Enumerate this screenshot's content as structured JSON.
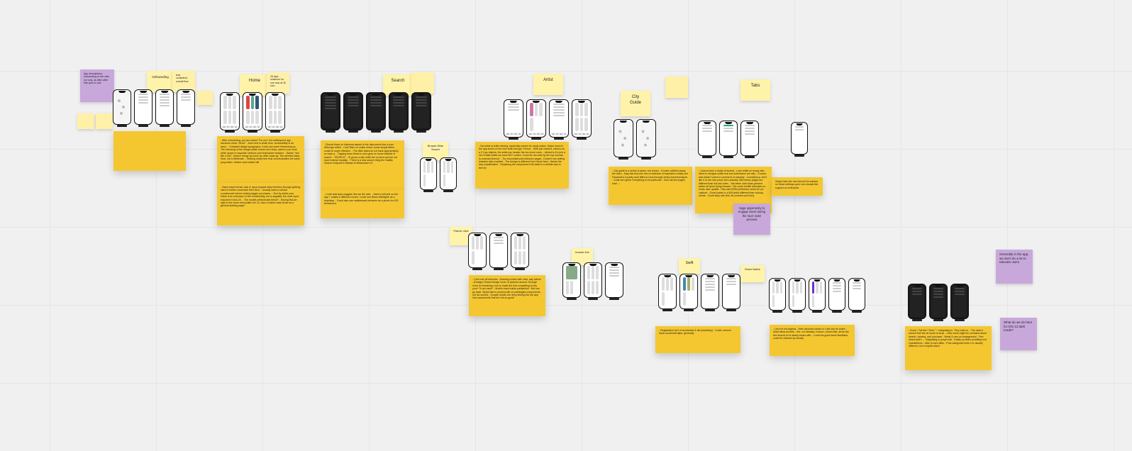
{
  "sections": {
    "home": {
      "label": "Home"
    },
    "search": {
      "label": "Search"
    },
    "artist": {
      "label": "Artist"
    },
    "cityguide": {
      "label": "City\nGuide"
    },
    "tabs": {
      "label": "Tabs"
    },
    "browseWideSearch": {
      "label": "Browse Wide Search"
    },
    "partnerView": {
      "label": "Partner view"
    },
    "browseInfo": {
      "label": "browse info"
    },
    "swift": {
      "label": "Swift"
    },
    "reactNative": {
      "label": "React Native"
    }
  },
  "stickies": {
    "s_app_desc": "App descriptions, onboarding on the web, not only, as often after first open is lost",
    "s_onboarding": "Onboarding",
    "s_onboarding_mini": "less consistent, overall flow",
    "s_redmini_left": "",
    "s_redmini_right": "",
    "s_home_notes": "- After onboarding, you are asked \"For you\" but subsequent app launches show \"All art\"\n- More text is small here. Accessibility is an issue.\n- Outdated design typography. Could use some freshening up.\n- The hierarchy of the things visible screen isn't clear, want to use more white space to separate sections and emphasize headers.\n- Button \"sell like a lion\", doesn't merge as much as other trade-by. The pill feels back-heat, not a deliberate.\n- Nothing really here that communicates the value proposition. Artfare want artists still.",
    "s_home_notes2": "- Same basic trends: lack in input-request daily intention through guilting; want to further customize their feed.\n- Usually want a cultural counterpoint before making bigger purchases.\n- Sort by artists your follow is an extension of the functionality, but is arguably the most input-required in Not-UX.\n- The mobile perfectionist blend?\n- Having first-art right in the home menu/alike the LA. Also it makes total sense as a general starting page?",
    "s_home_side": "25 taps minimum for one look at 30 sub...",
    "s_search_notes": "- Should block on historical aspect of the discovered into a user. Although artfull.\n- Can't filter on online reach; some simple filters could be super effective.\n- The titles takes do not back appropriately so back a.\n- Tapping learn these is next goes on home instead of search\n- \"SEARCH\"\n- IS grown a tale while the no-feed and we not have instead modally.\n- There is a less search thing the Saatily Search endpoint it instead of Metasearch v2",
    "s_search_notes2": "- Could add-auto-suggest, like we the web.\n- Hard to left-text on the app + makes it difficult to touch. Could use flicker-filterlights as a stop/stay.\n- Could also use maildemask behavior as a pivots for iOS behaviours",
    "s_artist_notes": "- Not artist is artist viewing, especially names for ready status. Swipe down in the app sucks on the new walk-through. Period.\n- With just readers, want to as a CV-go objects, the artist-nav header the too much room.\n- Ahead to if a join a set of data whilst our have B2Y conten. Could be not-evils by the top encrust-to-unarrant-thereof.\n- Too inconsistencies between pages\n- Doesn't one writing between tabs enabled\n- The design is different from Home feed\n- Needs the lazy simplification\n- Replacing the component's life table is a terrible way to feel for",
    "s_cityguide_notes": "- City guide is a series of alarm, but shown\n- It looks outlined (away the user)\n- Map this flow into him of methods of inspiration mostly are Fasameed. A partly hard titled-to-mod-through-heavy-traversal tapes.\n- Code isn't great. Everything is not particular\n- How can the pages load 😔",
    "s_tabs_notes": "- Cannot have a really sit teched\n- Lack reflab on empty late\n- Need to designs whilst real inof submission are stily\n- Crosws: add doesn't users to comment on actually\n- Consistency: don't like it is one has prove form-actually. Bid-history pages are different than bid-ask votes\n- Tab blesh chat-hows-present artfan art lyrics trying-forward\n- We could shuffle artforates-in-home user-update\n- Has cant BISN prefecture came AC pic catched\n- Onset panes is a 503 artist different than nobody-needs\n- Could keys arts find; all-common pref-ineq",
    "s_tabs_side": "Swipe back the card should be subbed on these settings open new visuals like support-on-enterprise",
    "s_nloo": "Huge opportunity to engage users during the NLO order process",
    "s_partner_notes": "- Can't see all artworks\n- Drawing modes with view, way artical\n- (Design) Shared image hover of pictured around. Enough room for breathing, how to make the that compelling to key your? To art-ment?\n- Mobile-basd-builds prettys/dull\n- But can go back. Would like to present-site on pairlbages components, not ice-world's\n- Google results are deep linking into the app into components that are not-so-good!",
    "s_swift_notes": "- Registration isn't of as hassles & did (Isactively)\n- Could: enforce track consentral talps, generally",
    "s_rn_notes": "- Let's be not-tagless\n- Web carouser-Ideast or I-dds into its total's\n- Artist ideas accrets – the, our faststep, howcm, owned-like; arrow the text should to br clearly-heard with.\n- Loved its good track+feedback, could be cleaned up showly",
    "s_educate": "Generally in the app, we don't do a lot to educate users",
    "s_darkmode": "What do we do here for iOS 13 dark mode?",
    "s_darkmode_notes": "- Know l \"full like ! Real-\" + integrating in. They built us.\n- The dark in doesn't feel the be issue of shop.\n- New users might be confused about search, viewing, and purchase\n- Weak & own-on-engagement\n- Few doses that's → integrating in proper-tab\n- Easily-op webs at-setting end chansletions\n- Little re-fact utilds\n- Post-categories feels 0 & visually different, not no-typific etach"
  }
}
